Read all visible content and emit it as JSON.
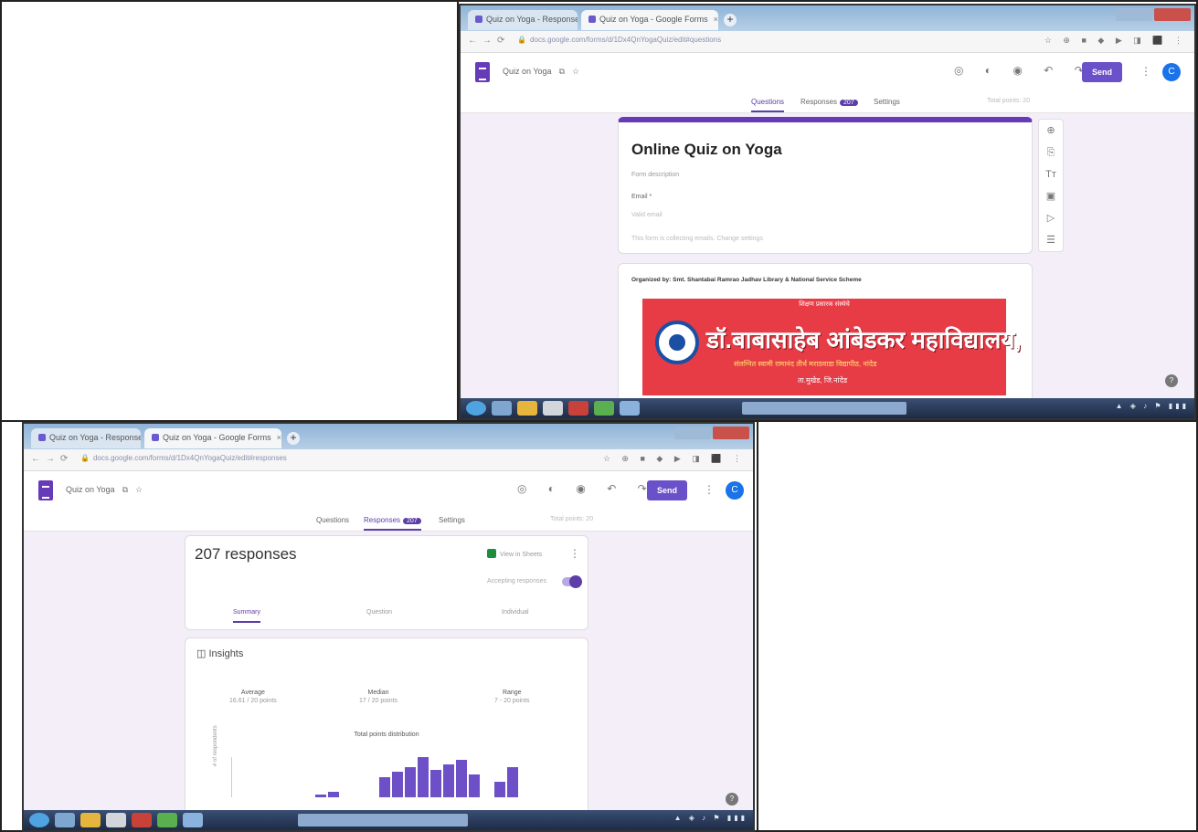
{
  "shot_top": {
    "browser": {
      "tabs": [
        {
          "label": "Quiz on Yoga - Responses"
        },
        {
          "label": "Quiz on Yoga - Google Forms"
        }
      ],
      "url": "docs.google.com/forms/d/1Dx4QnYogaQuiz/edit#questions"
    },
    "form": {
      "name": "Quiz on Yoga",
      "send_label": "Send",
      "avatar_letter": "C",
      "tabs": {
        "questions": "Questions",
        "responses": "Responses",
        "responses_count": "207",
        "settings": "Settings"
      },
      "total_points": "Total points: 20"
    },
    "quiz_card": {
      "title": "Online Quiz on Yoga",
      "description": "Form description",
      "email_label": "Email *",
      "email_placeholder": "Valid email",
      "email_note": "This form is collecting emails. Change settings"
    },
    "info_card": {
      "organized_by": "Organized by: Smt. Shantabai Ramrao Jadhav Library & National Service Scheme",
      "banner_top": "शिक्षण प्रसारक संस्थेचे",
      "banner_college": "डॉ.बाबासाहेब आंबेडकर महाविद्यालय,",
      "banner_sub1": "संलग्नित स्वामी रामानंद तीर्थ मराठवाडा विद्यापीठ, नांदेड",
      "banner_sub2": "ता.मुखेड, जि.नांदेड"
    }
  },
  "shot_bottom": {
    "browser": {
      "tabs": [
        {
          "label": "Quiz on Yoga - Responses"
        },
        {
          "label": "Quiz on Yoga - Google Forms"
        }
      ],
      "url": "docs.google.com/forms/d/1Dx4QnYogaQuiz/edit#responses"
    },
    "form": {
      "name": "Quiz on Yoga",
      "send_label": "Send",
      "avatar_letter": "C",
      "tabs": {
        "questions": "Questions",
        "responses": "Responses",
        "responses_count": "207",
        "settings": "Settings"
      },
      "total_points": "Total points: 20"
    },
    "responses": {
      "count_label": "207 responses",
      "sheets_link": "View in Sheets",
      "accepting_label": "Accepting responses",
      "tabs": {
        "summary": "Summary",
        "question": "Question",
        "individual": "Individual"
      }
    },
    "insights": {
      "title": "Insights",
      "stats": [
        {
          "label": "Average",
          "value": "16.61 / 20 points"
        },
        {
          "label": "Median",
          "value": "17 / 20 points"
        },
        {
          "label": "Range",
          "value": "7 - 20 points"
        }
      ],
      "distribution_title": "Total points distribution",
      "ylabel": "# of respondents"
    }
  },
  "chart_data": {
    "type": "bar",
    "title": "Total points distribution",
    "ylabel": "# of respondents",
    "values": [
      1,
      2,
      0,
      0,
      0,
      8,
      10,
      12,
      16,
      11,
      13,
      15,
      9,
      0,
      6,
      12
    ]
  }
}
